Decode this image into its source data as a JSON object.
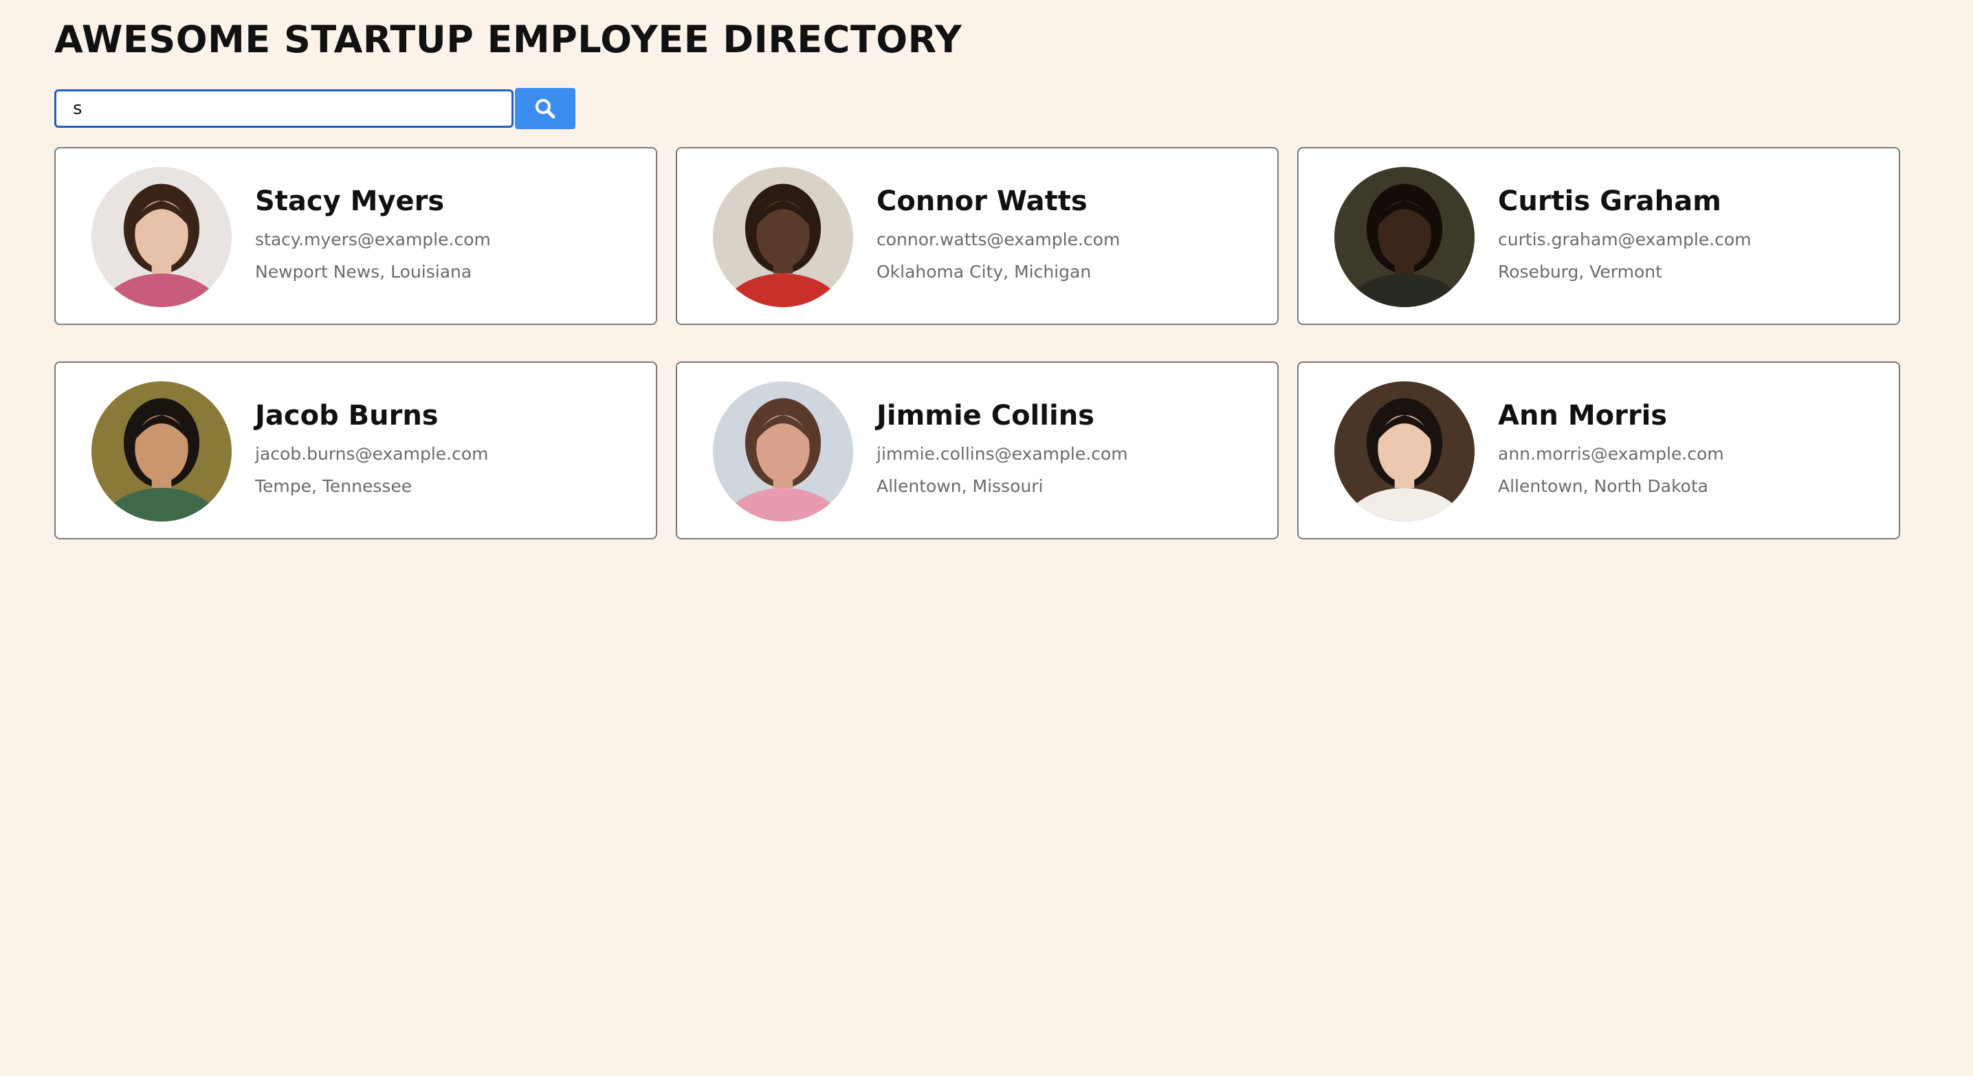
{
  "header": {
    "title": "AWESOME STARTUP EMPLOYEE DIRECTORY"
  },
  "search": {
    "value": "s",
    "placeholder": "",
    "button_icon": "search-icon",
    "button_color": "#3b8ef0"
  },
  "colors": {
    "background": "#fbf3ea",
    "card_background": "#ffffff",
    "card_border": "#7a7a7a",
    "input_border": "#1f5fbf"
  },
  "employees": [
    {
      "name": "Stacy Myers",
      "email": "stacy.myers@example.com",
      "location": "Newport News, Louisiana",
      "avatar": {
        "bg": "#e9e4e2",
        "skin": "#e8c2a8",
        "hair": "#3a2418",
        "shirt": "#c95c7a"
      }
    },
    {
      "name": "Connor Watts",
      "email": "connor.watts@example.com",
      "location": "Oklahoma City, Michigan",
      "avatar": {
        "bg": "#d9d2c8",
        "skin": "#5a3a28",
        "hair": "#2a1a12",
        "shirt": "#c8302a"
      }
    },
    {
      "name": "Curtis Graham",
      "email": "curtis.graham@example.com",
      "location": "Roseburg, Vermont",
      "avatar": {
        "bg": "#3d3a2a",
        "skin": "#3b2418",
        "hair": "#140c08",
        "shirt": "#2a2a22"
      }
    },
    {
      "name": "Jacob Burns",
      "email": "jacob.burns@example.com",
      "location": "Tempe, Tennessee",
      "avatar": {
        "bg": "#8a7a3a",
        "skin": "#c9966e",
        "hair": "#1a1410",
        "shirt": "#3f6a4a"
      }
    },
    {
      "name": "Jimmie Collins",
      "email": "jimmie.collins@example.com",
      "location": "Allentown, Missouri",
      "avatar": {
        "bg": "#cfd6dd",
        "skin": "#d9a08a",
        "hair": "#5a3a2a",
        "shirt": "#e89ab0"
      }
    },
    {
      "name": "Ann Morris",
      "email": "ann.morris@example.com",
      "location": "Allentown, North Dakota",
      "avatar": {
        "bg": "#4a3526",
        "skin": "#ecc9ae",
        "hair": "#1a120e",
        "shirt": "#f2ede6"
      }
    }
  ]
}
